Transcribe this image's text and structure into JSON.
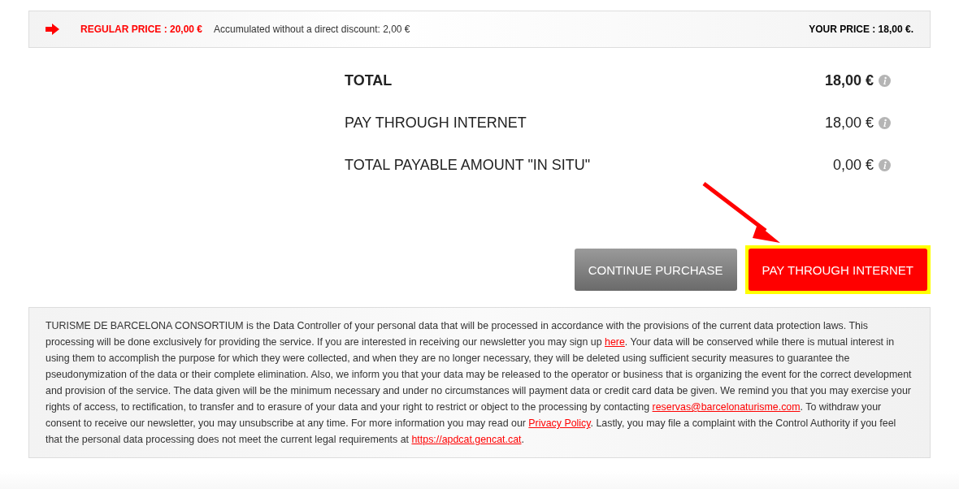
{
  "price_bar": {
    "regular_price": "REGULAR PRICE : 20,00 €",
    "discount_note": "Accumulated without a direct discount: 2,00 €",
    "your_price": "YOUR PRICE : 18,00 €."
  },
  "totals": [
    {
      "label": "TOTAL",
      "amount": "18,00 €",
      "bold": true
    },
    {
      "label": "PAY THROUGH INTERNET",
      "amount": "18,00 €",
      "bold": false
    },
    {
      "label": "TOTAL PAYABLE AMOUNT \"IN SITU\"",
      "amount": "0,00 €",
      "bold": false
    }
  ],
  "buttons": [
    {
      "label": "CONTINUE PURCHASE",
      "kind": "secondary",
      "highlighted": false
    },
    {
      "label": "PAY THROUGH INTERNET",
      "kind": "primary",
      "highlighted": true
    }
  ],
  "notice": [
    {
      "kind": "text",
      "text": "TURISME DE BARCELONA CONSORTIUM is the Data Controller of your personal data that will be processed in accordance with the provisions of the current data protection laws. This processing will be done exclusively for providing the service. If you are interested in receiving our newsletter you may sign up "
    },
    {
      "kind": "link",
      "text": "here"
    },
    {
      "kind": "text",
      "text": ". Your data will be conserved while there is mutual interest in using them to accomplish the purpose for which they were collected, and when they are no longer necessary, they will be deleted using sufficient security measures to guarantee the pseudonymization of the data or their complete elimination. Also, we inform you that your data may be released to the operator or business that is organizing the event for the correct development and provision of the service. The data given will be the minimum necessary and under no circumstances will payment data or credit card data be given. We remind you that you may exercise your rights of access, to rectification, to transfer and to erasure of your data and your right to restrict or object to the processing by contacting "
    },
    {
      "kind": "link",
      "text": "reservas@barcelonaturisme.com"
    },
    {
      "kind": "text",
      "text": ". To withdraw your consent to receive our newsletter, you may unsubscribe at any time. For more information you may read our "
    },
    {
      "kind": "link",
      "text": "Privacy Policy"
    },
    {
      "kind": "text",
      "text": ". Lastly, you may file a complaint with the Control Authority if you feel that the personal data processing does not meet the current legal requirements at "
    },
    {
      "kind": "link",
      "text": "https://apdcat.gencat.cat"
    },
    {
      "kind": "text",
      "text": "."
    }
  ]
}
